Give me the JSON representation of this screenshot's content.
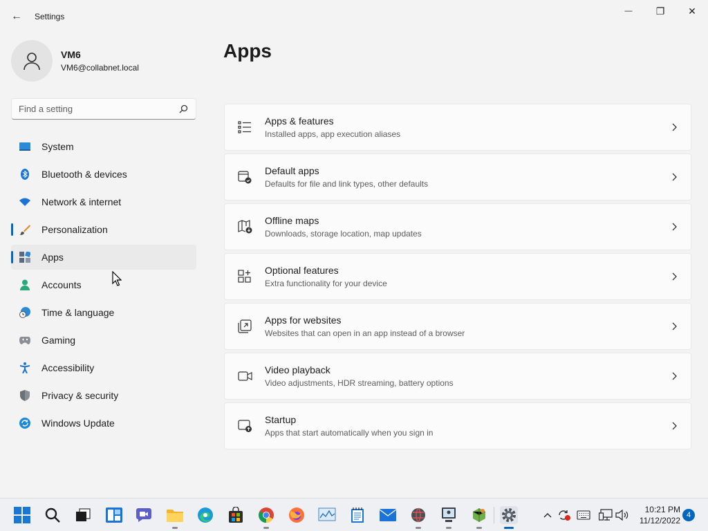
{
  "window": {
    "title": "Settings",
    "back_glyph": "←",
    "minimize_glyph": "—",
    "maximize_glyph": "❐",
    "close_glyph": "✕"
  },
  "profile": {
    "name": "VM6",
    "email": "VM6@collabnet.local"
  },
  "search": {
    "placeholder": "Find a setting",
    "value": ""
  },
  "sidebar": {
    "items": [
      {
        "label": "System",
        "icon": "system-icon"
      },
      {
        "label": "Bluetooth & devices",
        "icon": "bluetooth-icon"
      },
      {
        "label": "Network & internet",
        "icon": "wifi-icon"
      },
      {
        "label": "Personalization",
        "icon": "brush-icon"
      },
      {
        "label": "Apps",
        "icon": "apps-icon",
        "selected": true
      },
      {
        "label": "Accounts",
        "icon": "person-icon"
      },
      {
        "label": "Time & language",
        "icon": "clock-globe-icon"
      },
      {
        "label": "Gaming",
        "icon": "gamepad-icon"
      },
      {
        "label": "Accessibility",
        "icon": "accessibility-icon"
      },
      {
        "label": "Privacy & security",
        "icon": "shield-icon"
      },
      {
        "label": "Windows Update",
        "icon": "update-icon"
      }
    ]
  },
  "main": {
    "title": "Apps",
    "cards": [
      {
        "title": "Apps & features",
        "subtitle": "Installed apps, app execution aliases",
        "icon": "list-icon"
      },
      {
        "title": "Default apps",
        "subtitle": "Defaults for file and link types, other defaults",
        "icon": "default-apps-icon"
      },
      {
        "title": "Offline maps",
        "subtitle": "Downloads, storage location, map updates",
        "icon": "map-download-icon"
      },
      {
        "title": "Optional features",
        "subtitle": "Extra functionality for your device",
        "icon": "grid-plus-icon"
      },
      {
        "title": "Apps for websites",
        "subtitle": "Websites that can open in an app instead of a browser",
        "icon": "open-in-app-icon"
      },
      {
        "title": "Video playback",
        "subtitle": "Video adjustments, HDR streaming, battery options",
        "icon": "video-icon"
      },
      {
        "title": "Startup",
        "subtitle": "Apps that start automatically when you sign in",
        "icon": "startup-icon"
      }
    ]
  },
  "taskbar": {
    "time": "10:21 PM",
    "date": "11/12/2022",
    "notification_count": "4",
    "colors": {
      "accent": "#0067c0"
    }
  }
}
